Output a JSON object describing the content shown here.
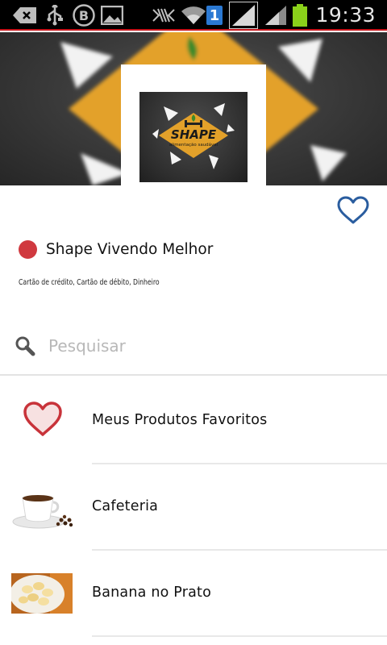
{
  "status_bar": {
    "time": "19:33",
    "sim_badge": "1",
    "icons": [
      "back-arrow-notification-icon",
      "usb-icon",
      "blogger-b-icon",
      "image-icon",
      "vibrate-icon",
      "wifi-icon",
      "sim-badge-icon",
      "signal-icon",
      "signal-icon-2",
      "battery-icon"
    ]
  },
  "banner": {
    "logo_title": "SHAPE",
    "logo_subtitle": "alimentação saudável"
  },
  "store": {
    "name": "Shape Vivendo Melhor",
    "payments": "Cartão de crédito, Cartão de débito, Dinheiro",
    "status_color": "#d0393f"
  },
  "search": {
    "placeholder": "Pesquisar"
  },
  "categories": [
    {
      "label": "Meus Produtos Favoritos",
      "icon": "heart-icon"
    },
    {
      "label": "Cafeteria",
      "icon": "coffee-cup-image"
    },
    {
      "label": "Banana no Prato",
      "icon": "banana-plate-image"
    }
  ],
  "colors": {
    "accent_red": "#d0393f",
    "heart_blue": "#2a5d9f",
    "status_bar_line": "#c8141b",
    "logo_yellow": "#e3a12a"
  }
}
